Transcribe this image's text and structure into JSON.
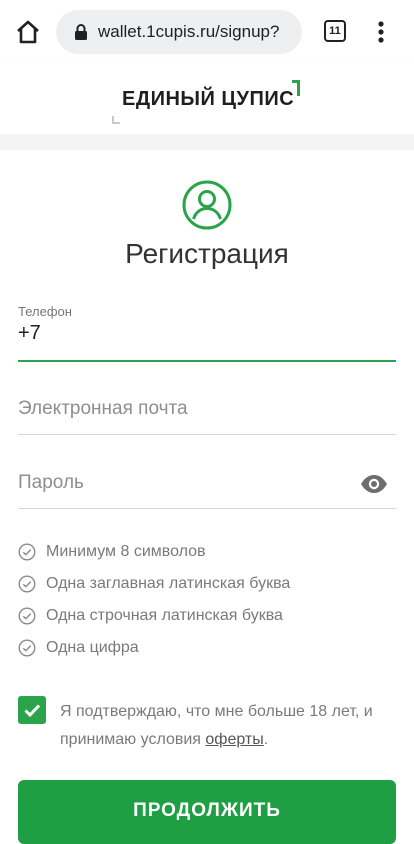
{
  "browser": {
    "url": "wallet.1cupis.ru/signup?",
    "tab_count": "11",
    "icons": {
      "home": "home-icon",
      "lock": "lock-icon",
      "menu": "more-vert-icon"
    }
  },
  "site": {
    "logo_text": "ЕДИНЫЙ ЦУПИС",
    "logo_mark": "1",
    "brand_color": "#2aa34a"
  },
  "form": {
    "title": "Регистрация",
    "phone": {
      "label": "Телефон",
      "value": "+7"
    },
    "email": {
      "placeholder": "Электронная почта"
    },
    "password": {
      "placeholder": "Пароль"
    },
    "rules": [
      "Минимум 8 символов",
      "Одна заглавная латинская буква",
      "Одна строчная латинская буква",
      "Одна цифра"
    ],
    "confirm": {
      "checked": true,
      "text_before": "Я подтверждаю, что мне больше 18 лет, и принимаю условия ",
      "link": "оферты",
      "text_after": "."
    },
    "submit_label": "ПРОДОЛЖИТЬ"
  }
}
